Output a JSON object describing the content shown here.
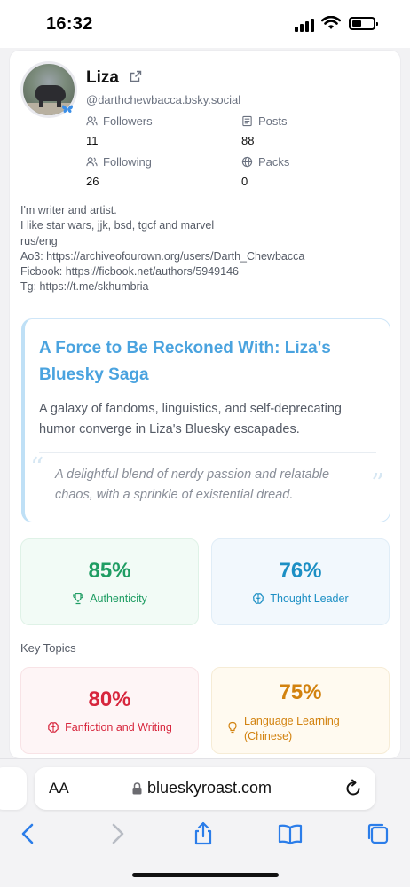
{
  "status": {
    "time": "16:32"
  },
  "profile": {
    "name": "Liza",
    "handle": "@darthchewbacca.bsky.social",
    "stats": {
      "followers_label": "Followers",
      "followers_value": "11",
      "posts_label": "Posts",
      "posts_value": "88",
      "following_label": "Following",
      "following_value": "26",
      "packs_label": "Packs",
      "packs_value": "0"
    },
    "bio": [
      "I'm writer and artist.",
      "I like star wars, jjk, bsd, tgcf and marvel",
      "rus/eng",
      "Ao3: https://archiveofourown.org/users/Darth_Chewbacca",
      "Ficbook: https://ficbook.net/authors/5949146",
      "Tg: https://t.me/skhumbria"
    ]
  },
  "roast": {
    "title": "A Force to Be Reckoned With: Liza's Bluesky Saga",
    "description": "A galaxy of fandoms, linguistics, and self-deprecating humor converge in Liza's Bluesky escapades.",
    "quote": "A delightful blend of nerdy passion and relatable chaos, with a sprinkle of existential dread."
  },
  "metrics": [
    {
      "value": "85%",
      "label": "Authenticity",
      "icon": "trophy-icon",
      "color": "#1f9d63"
    },
    {
      "value": "76%",
      "label": "Thought Leader",
      "icon": "brain-icon",
      "color": "#1c8fc4"
    }
  ],
  "key_topics": {
    "heading": "Key Topics",
    "items": [
      {
        "value": "80%",
        "label": "Fanfiction and Writing",
        "icon": "brain-icon",
        "color": "#d7263d"
      },
      {
        "value": "75%",
        "label_line1": "Language Learning",
        "label_line2": "(Chinese)",
        "icon": "lightbulb-icon",
        "color": "#d2820f"
      }
    ]
  },
  "browser": {
    "text_size_label": "AA",
    "url": "blueskyroast.com"
  }
}
